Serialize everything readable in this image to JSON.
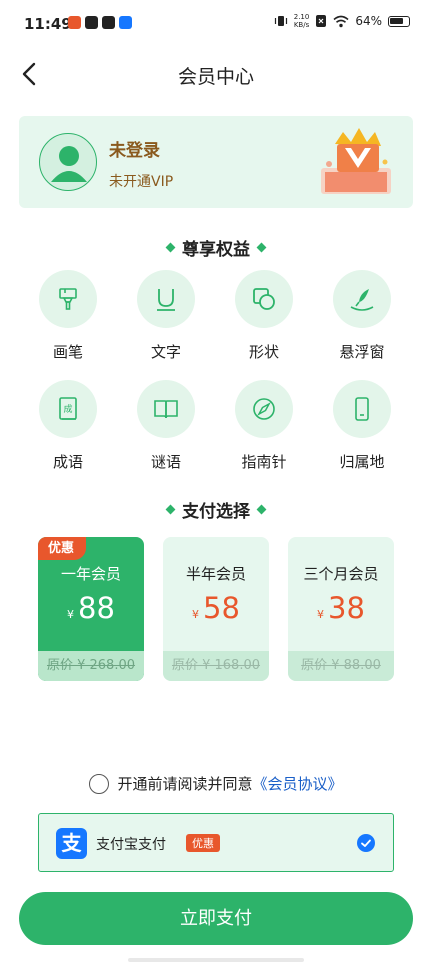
{
  "status_bar": {
    "time": "11:49",
    "net_speed_value": "2.10",
    "net_speed_unit": "KB/s",
    "battery": "64%"
  },
  "header": {
    "title": "会员中心"
  },
  "user": {
    "name": "未登录",
    "vip_status": "未开通VIP"
  },
  "benefits": {
    "title": "尊享权益",
    "items": [
      {
        "label": "画笔",
        "icon": "brush-icon"
      },
      {
        "label": "文字",
        "icon": "text-icon"
      },
      {
        "label": "形状",
        "icon": "shape-icon"
      },
      {
        "label": "悬浮窗",
        "icon": "floating-window-icon"
      },
      {
        "label": "成语",
        "icon": "idiom-book-icon"
      },
      {
        "label": "谜语",
        "icon": "riddle-book-icon"
      },
      {
        "label": "指南针",
        "icon": "compass-icon"
      },
      {
        "label": "归属地",
        "icon": "phone-location-icon"
      }
    ]
  },
  "payment": {
    "title": "支付选择",
    "plans": [
      {
        "name": "一年会员",
        "currency": "¥",
        "price": "88",
        "original": "原价 ¥ 268.00",
        "badge": "优惠",
        "selected": true
      },
      {
        "name": "半年会员",
        "currency": "¥",
        "price": "58",
        "original": "原价 ¥ 168.00",
        "selected": false
      },
      {
        "name": "三个月会员",
        "currency": "¥",
        "price": "38",
        "original": "原价 ¥ 88.00",
        "selected": false
      }
    ]
  },
  "agreement": {
    "text": "开通前请阅读并同意",
    "link": "《会员协议》"
  },
  "method": {
    "icon_char": "支",
    "label": "支付宝支付",
    "badge": "优惠"
  },
  "pay_button": "立即支付",
  "colors": {
    "accent": "#2db36a",
    "accent_light": "#e6f7ee",
    "price": "#e8572c",
    "link": "#1a5fc8",
    "alipay": "#1677ff"
  }
}
